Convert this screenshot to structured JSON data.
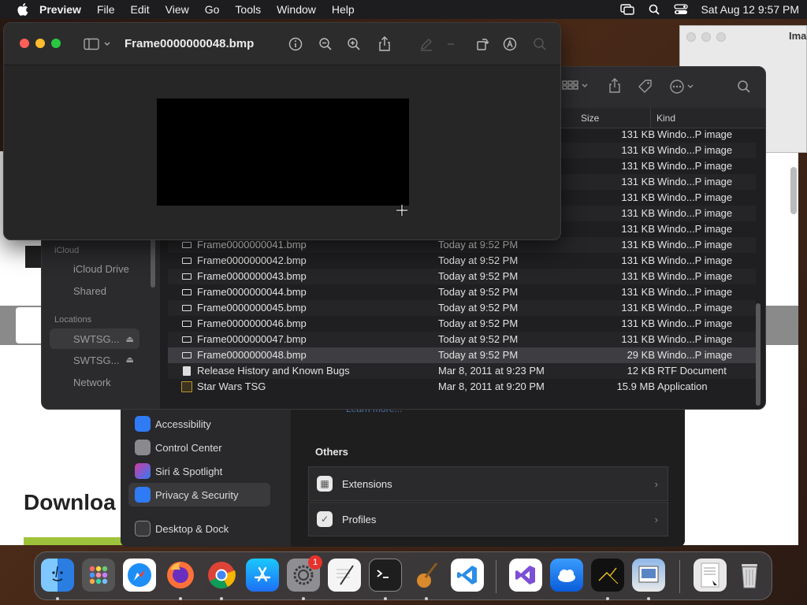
{
  "menubar": {
    "app": "Preview",
    "items": [
      "File",
      "Edit",
      "View",
      "Go",
      "Tools",
      "Window",
      "Help"
    ],
    "clock": "Sat Aug 12  9:57 PM"
  },
  "browser": {
    "heading": "Downloa"
  },
  "image_window": {
    "title": "Ima"
  },
  "preview": {
    "title": "Frame0000000048.bmp"
  },
  "finder": {
    "columns": {
      "size": "Size",
      "kind": "Kind"
    },
    "sidebar": {
      "icloud_header": "iCloud",
      "icloud_drive": "iCloud Drive",
      "shared": "Shared",
      "locations_header": "Locations",
      "loc1": "SWTSG...",
      "loc2": "SWTSG...",
      "network": "Network"
    },
    "rows": [
      {
        "name": "",
        "date": "",
        "size": "131 KB",
        "kind": "Windo...P image"
      },
      {
        "name": "",
        "date": "",
        "size": "131 KB",
        "kind": "Windo...P image"
      },
      {
        "name": "",
        "date": "",
        "size": "131 KB",
        "kind": "Windo...P image"
      },
      {
        "name": "",
        "date": "",
        "size": "131 KB",
        "kind": "Windo...P image"
      },
      {
        "name": "",
        "date": "",
        "size": "131 KB",
        "kind": "Windo...P image"
      },
      {
        "name": "",
        "date": "",
        "size": "131 KB",
        "kind": "Windo...P image"
      },
      {
        "name": "",
        "date": "",
        "size": "131 KB",
        "kind": "Windo...P image"
      },
      {
        "name": "Frame0000000041.bmp",
        "date": "Today at 9:52 PM",
        "size": "131 KB",
        "kind": "Windo...P image"
      },
      {
        "name": "Frame0000000042.bmp",
        "date": "Today at 9:52 PM",
        "size": "131 KB",
        "kind": "Windo...P image"
      },
      {
        "name": "Frame0000000043.bmp",
        "date": "Today at 9:52 PM",
        "size": "131 KB",
        "kind": "Windo...P image"
      },
      {
        "name": "Frame0000000044.bmp",
        "date": "Today at 9:52 PM",
        "size": "131 KB",
        "kind": "Windo...P image"
      },
      {
        "name": "Frame0000000045.bmp",
        "date": "Today at 9:52 PM",
        "size": "131 KB",
        "kind": "Windo...P image"
      },
      {
        "name": "Frame0000000046.bmp",
        "date": "Today at 9:52 PM",
        "size": "131 KB",
        "kind": "Windo...P image"
      },
      {
        "name": "Frame0000000047.bmp",
        "date": "Today at 9:52 PM",
        "size": "131 KB",
        "kind": "Windo...P image"
      },
      {
        "name": "Frame0000000048.bmp",
        "date": "Today at 9:52 PM",
        "size": "29 KB",
        "kind": "Windo...P image"
      },
      {
        "name": "Release History and Known Bugs",
        "date": "Mar 8, 2011 at 9:23 PM",
        "size": "12 KB",
        "kind": "RTF Document"
      },
      {
        "name": "Star Wars TSG",
        "date": "Mar 8, 2011 at 9:20 PM",
        "size": "15.9 MB",
        "kind": "Application"
      }
    ]
  },
  "settings": {
    "learn_more": "Learn more...",
    "sidebar": [
      "Accessibility",
      "Control Center",
      "Siri & Spotlight",
      "Privacy & Security",
      "Desktop & Dock"
    ],
    "others_header": "Others",
    "extensions": "Extensions",
    "profiles": "Profiles"
  },
  "dock": {
    "settings_badge": "1"
  }
}
